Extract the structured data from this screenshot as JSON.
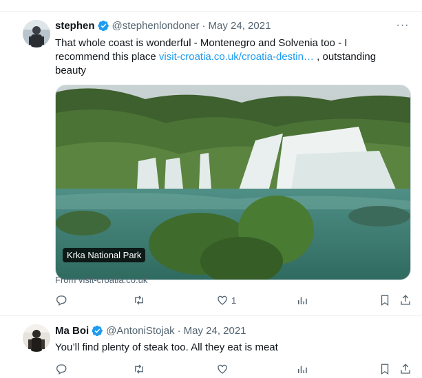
{
  "tweets": [
    {
      "name": "stephen",
      "handle": "@stephenlondoner",
      "separator": "·",
      "date": "May 24, 2021",
      "text_before": "That whole coast is wonderful - Montenegro and Solvenia too - I recommend this place ",
      "link": "visit-croatia.co.uk/croatia-destin…",
      "text_after": " , outstanding beauty",
      "media_caption": "Krka National Park",
      "source": "From visit-croatia.co.uk",
      "likes": "1"
    },
    {
      "name": "Ma Boi",
      "handle": "@AntoniStojak",
      "separator": "·",
      "date": "May 24, 2021",
      "text": "You’ll find plenty of steak too. All they eat is meat"
    }
  ],
  "icons": {
    "verified": "verified-badge-icon",
    "more": "more-icon",
    "reply": "reply-icon",
    "retweet": "retweet-icon",
    "like": "like-icon",
    "views": "views-icon",
    "bookmark": "bookmark-icon",
    "share": "share-icon"
  },
  "colors": {
    "link": "#1d9bf0",
    "secondary_text": "#536471",
    "verified": "#1d9bf0"
  }
}
